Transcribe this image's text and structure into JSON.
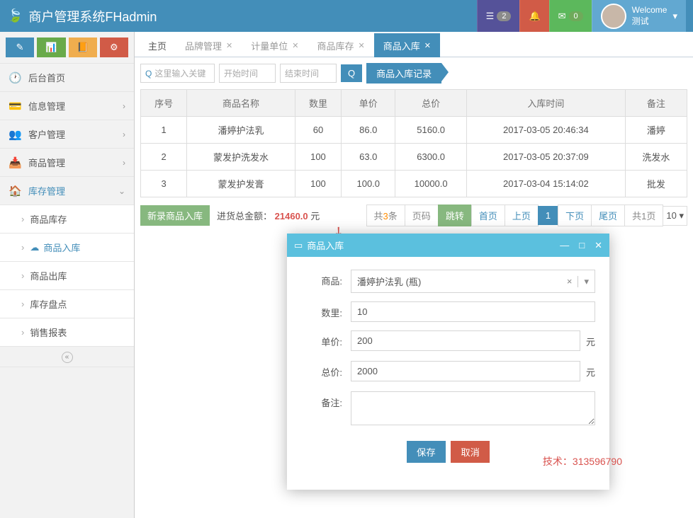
{
  "header": {
    "title": "商户管理系统FHadmin",
    "badge_tasks": "2",
    "badge_mail": "0",
    "welcome_label": "Welcome",
    "welcome_user": "测试"
  },
  "sidebar": {
    "items": [
      {
        "icon": "🕐",
        "label": "后台首页"
      },
      {
        "icon": "💳",
        "label": "信息管理",
        "has_children": true
      },
      {
        "icon": "👥",
        "label": "客户管理",
        "has_children": true
      },
      {
        "icon": "📥",
        "label": "商品管理",
        "has_children": true
      },
      {
        "icon": "🏠",
        "label": "库存管理",
        "has_children": true,
        "expanded": true
      }
    ],
    "sub_items": [
      {
        "label": "商品库存"
      },
      {
        "label": "商品入库",
        "active": true,
        "icon": "☁"
      },
      {
        "label": "商品出库"
      },
      {
        "label": "库存盘点"
      },
      {
        "label": "销售报表"
      }
    ]
  },
  "tabs": [
    {
      "label": "主页",
      "fixed": true
    },
    {
      "label": "品牌管理",
      "closable": true
    },
    {
      "label": "计量单位",
      "closable": true
    },
    {
      "label": "商品库存",
      "closable": true
    },
    {
      "label": "商品入库",
      "closable": true,
      "active": true
    }
  ],
  "toolbar": {
    "search_placeholder": "这里输入关键",
    "start_date": "开始时间",
    "end_date": "结束时间",
    "record_btn": "商品入库记录"
  },
  "table": {
    "headers": [
      "序号",
      "商品名称",
      "数里",
      "单价",
      "总价",
      "入库时间",
      "备注"
    ],
    "rows": [
      [
        "1",
        "潘婷护法乳",
        "60",
        "86.0",
        "5160.0",
        "2017-03-05 20:46:34",
        "潘婷"
      ],
      [
        "2",
        "蒙发护洗发水",
        "100",
        "63.0",
        "6300.0",
        "2017-03-05 20:37:09",
        "洗发水"
      ],
      [
        "3",
        "蒙发护发膏",
        "100",
        "100.0",
        "10000.0",
        "2017-03-04 15:14:02",
        "批发"
      ]
    ]
  },
  "footer": {
    "new_btn": "新录商品入库",
    "amount_label": "进货总金额：",
    "amount_value": "21460.0",
    "amount_unit": "元",
    "total_prefix": "共",
    "total_count": "3",
    "total_suffix": "条",
    "page_input": "页码",
    "jump": "跳转",
    "first": "首页",
    "prev": "上页",
    "current": "1",
    "next": "下页",
    "last": "尾页",
    "pages_prefix": "共",
    "pages_count": "1",
    "pages_suffix": "页",
    "page_size": "10"
  },
  "dialog": {
    "title": "商品入库",
    "labels": {
      "product": "商品:",
      "qty": "数里:",
      "price": "单价:",
      "total": "总价:",
      "remark": "备注:"
    },
    "values": {
      "product": "潘婷护法乳 (瓶)",
      "qty": "10",
      "price": "200",
      "total": "2000",
      "unit": "元"
    },
    "save": "保存",
    "cancel": "取消"
  },
  "tech_note": "技术：313596790"
}
